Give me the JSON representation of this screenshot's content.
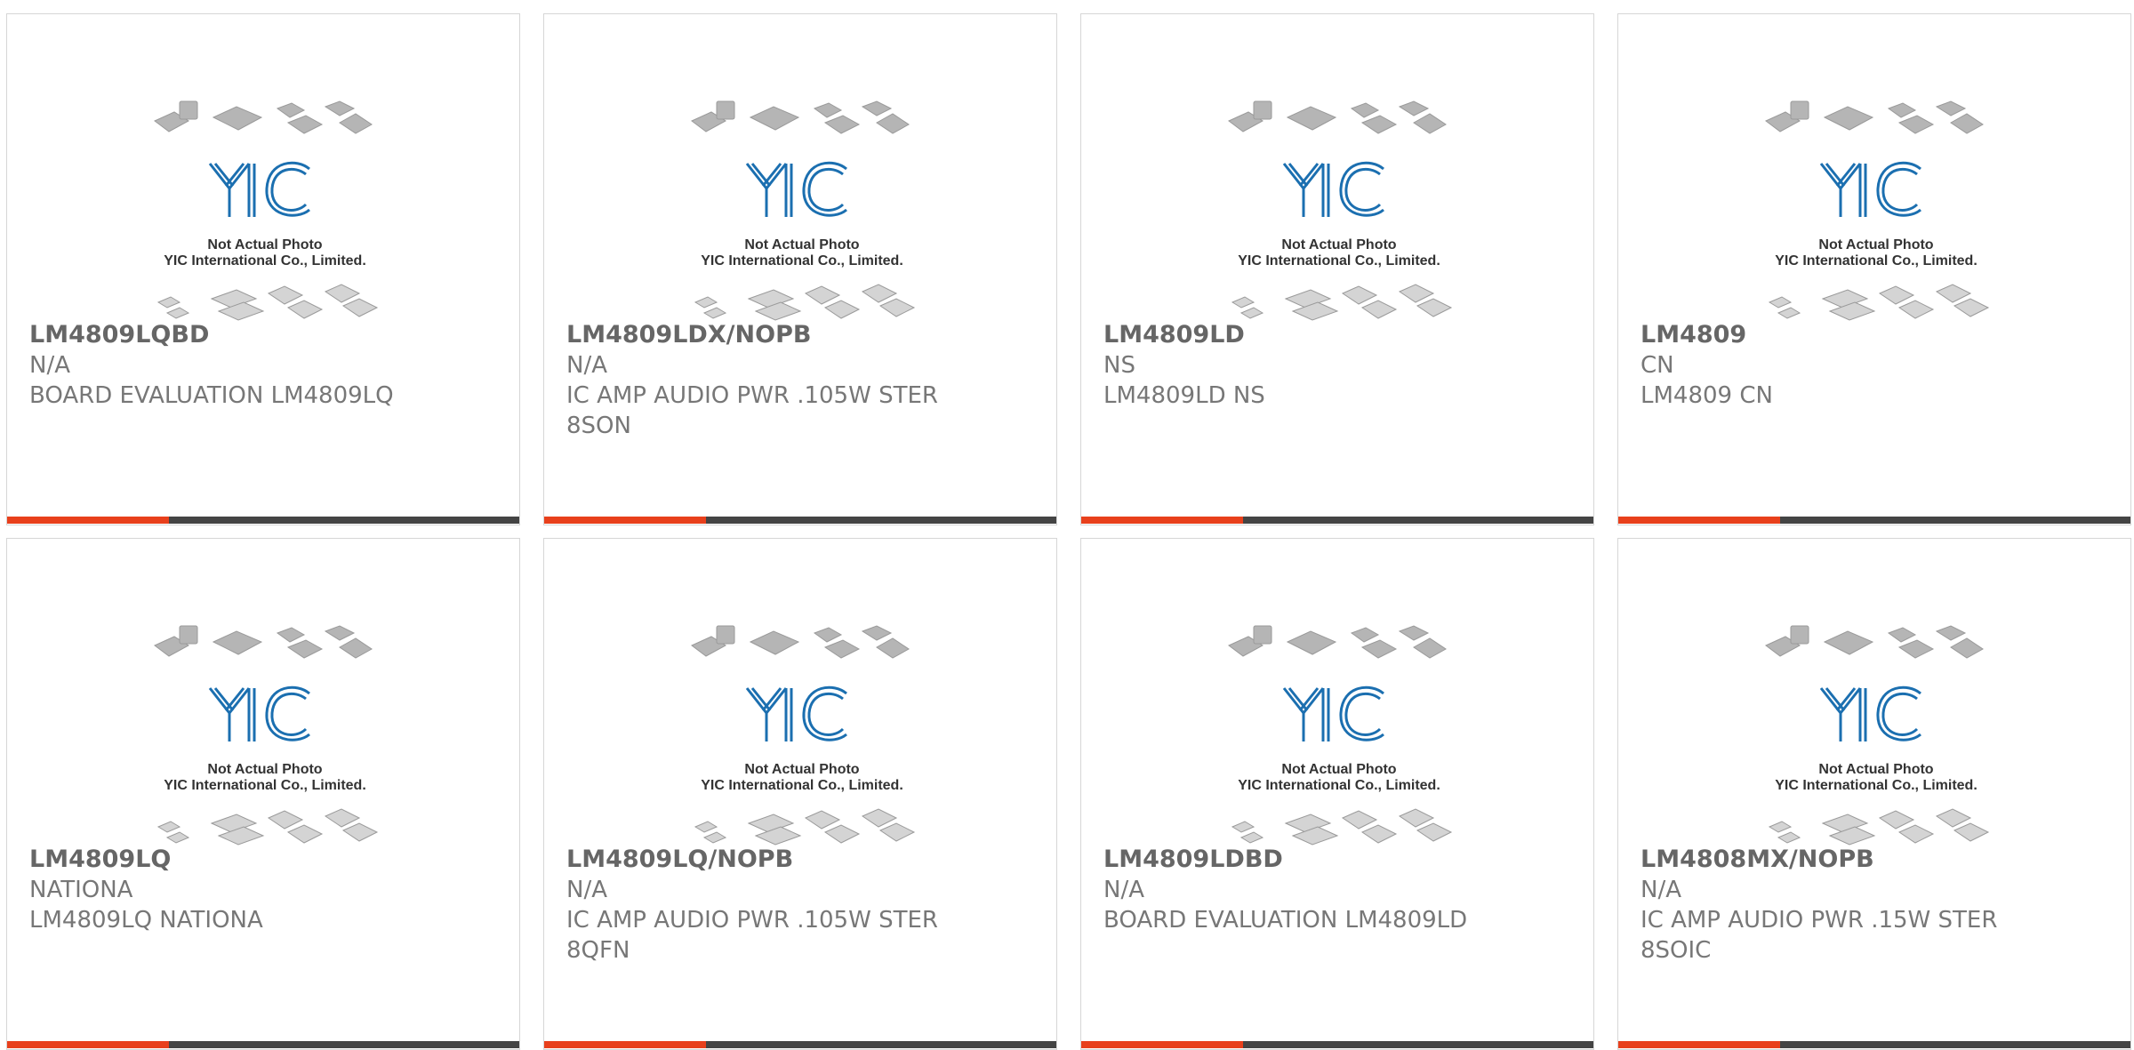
{
  "accent_color": "#e8401c",
  "bar_color": "#444444",
  "image_placeholder": {
    "line1": "Not Actual Photo",
    "line2": "YIC International Co., Limited.",
    "logo_icon": "yic-logo-icon"
  },
  "products": [
    {
      "part": "LM4809LQBD",
      "manufacturer": "N/A",
      "description": "BOARD EVALUATION LM4809LQ"
    },
    {
      "part": "LM4809LDX/NOPB",
      "manufacturer": "N/A",
      "description": "IC AMP AUDIO PWR .105W STER 8SON"
    },
    {
      "part": "LM4809LD",
      "manufacturer": "NS",
      "description": "LM4809LD NS"
    },
    {
      "part": "LM4809",
      "manufacturer": "CN",
      "description": "LM4809 CN"
    },
    {
      "part": "LM4809LQ",
      "manufacturer": "NATIONA",
      "description": "LM4809LQ NATIONA"
    },
    {
      "part": "LM4809LQ/NOPB",
      "manufacturer": "N/A",
      "description": "IC AMP AUDIO PWR .105W STER 8QFN"
    },
    {
      "part": "LM4809LDBD",
      "manufacturer": "N/A",
      "description": "BOARD EVALUATION LM4809LD"
    },
    {
      "part": "LM4808MX/NOPB",
      "manufacturer": "N/A",
      "description": "IC AMP AUDIO PWR .15W STER 8SOIC"
    }
  ]
}
